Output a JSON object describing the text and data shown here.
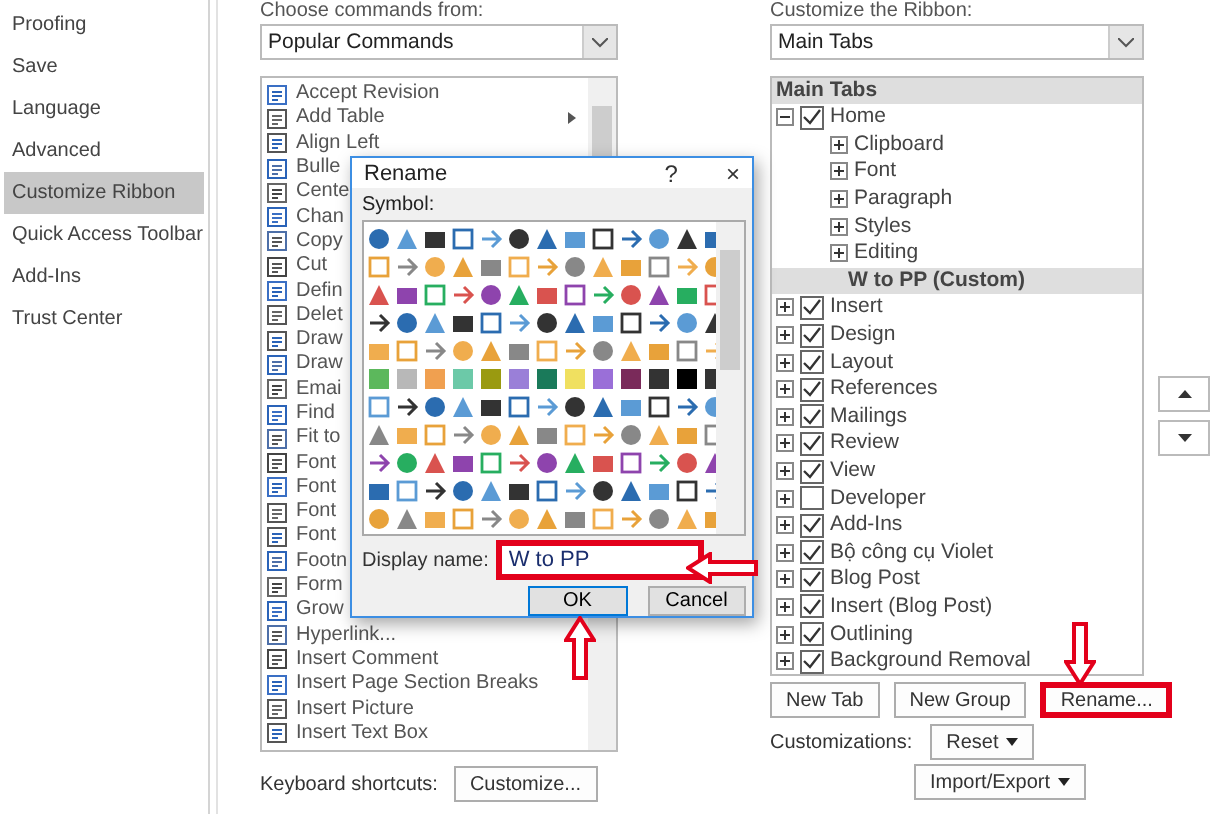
{
  "sidebar": {
    "items": [
      {
        "label": "Proofing",
        "selected": false
      },
      {
        "label": "Save",
        "selected": false
      },
      {
        "label": "Language",
        "selected": false
      },
      {
        "label": "Advanced",
        "selected": false
      },
      {
        "label": "Customize Ribbon",
        "selected": true
      },
      {
        "label": "Quick Access Toolbar",
        "selected": false
      },
      {
        "label": "Add-Ins",
        "selected": false
      },
      {
        "label": "Trust Center",
        "selected": false
      }
    ]
  },
  "commands": {
    "label": "Choose commands from:",
    "dropdown": "Popular Commands",
    "items": [
      {
        "label": "Accept Revision"
      },
      {
        "label": "Add Table",
        "submenu": true
      },
      {
        "label": "Align Left"
      },
      {
        "label": "Bulle"
      },
      {
        "label": "Cente"
      },
      {
        "label": "Chan"
      },
      {
        "label": "Copy"
      },
      {
        "label": "Cut"
      },
      {
        "label": "Defin"
      },
      {
        "label": "Delet"
      },
      {
        "label": "Draw"
      },
      {
        "label": "Draw"
      },
      {
        "label": "Emai"
      },
      {
        "label": "Find"
      },
      {
        "label": "Fit to"
      },
      {
        "label": "Font"
      },
      {
        "label": "Font"
      },
      {
        "label": "Font"
      },
      {
        "label": "Font"
      },
      {
        "label": "Footn"
      },
      {
        "label": "Form"
      },
      {
        "label": "Grow"
      },
      {
        "label": "Hyperlink..."
      },
      {
        "label": "Insert Comment"
      },
      {
        "label": "Insert Page  Section Breaks"
      },
      {
        "label": "Insert Picture"
      },
      {
        "label": "Insert Text Box"
      }
    ],
    "shortcuts_label": "Keyboard shortcuts:",
    "customize_button": "Customize..."
  },
  "ribbon": {
    "label": "Customize the Ribbon:",
    "dropdown": "Main Tabs",
    "header": "Main Tabs",
    "tabs": [
      {
        "label": "Home",
        "checked": true,
        "expanded": true,
        "children": [
          {
            "label": "Clipboard",
            "kind": "group",
            "selected": false
          },
          {
            "label": "Font",
            "kind": "group",
            "selected": false
          },
          {
            "label": "Paragraph",
            "kind": "group",
            "selected": false
          },
          {
            "label": "Styles",
            "kind": "group",
            "selected": false
          },
          {
            "label": "Editing",
            "kind": "group",
            "selected": false
          },
          {
            "label": "W to PP (Custom)",
            "kind": "custom",
            "selected": true
          }
        ]
      },
      {
        "label": "Insert",
        "checked": true,
        "expanded": false
      },
      {
        "label": "Design",
        "checked": true,
        "expanded": false
      },
      {
        "label": "Layout",
        "checked": true,
        "expanded": false
      },
      {
        "label": "References",
        "checked": true,
        "expanded": false
      },
      {
        "label": "Mailings",
        "checked": true,
        "expanded": false
      },
      {
        "label": "Review",
        "checked": true,
        "expanded": false
      },
      {
        "label": "View",
        "checked": true,
        "expanded": false
      },
      {
        "label": "Developer",
        "checked": false,
        "expanded": false
      },
      {
        "label": "Add-Ins",
        "checked": true,
        "expanded": false
      },
      {
        "label": "Bộ công cụ Violet",
        "checked": true,
        "expanded": false
      },
      {
        "label": "Blog Post",
        "checked": true,
        "expanded": false
      },
      {
        "label": "Insert (Blog Post)",
        "checked": true,
        "expanded": false
      },
      {
        "label": "Outlining",
        "checked": true,
        "expanded": false
      },
      {
        "label": "Background Removal",
        "checked": true,
        "expanded": false
      }
    ],
    "buttons": [
      {
        "label": "New Tab",
        "highlighted": false
      },
      {
        "label": "New Group",
        "highlighted": false
      },
      {
        "label": "Rename...",
        "highlighted": true
      }
    ],
    "customizations_label": "Customizations:",
    "reset_button": "Reset",
    "import_export_button": "Import/Export"
  },
  "dialog": {
    "title": "Rename",
    "help": "?",
    "close": "×",
    "symbol_label": "Symbol:",
    "display_name_label": "Display name:",
    "display_name": "W to PP",
    "display_name_highlighted": true,
    "ok": "OK",
    "cancel": "Cancel"
  }
}
